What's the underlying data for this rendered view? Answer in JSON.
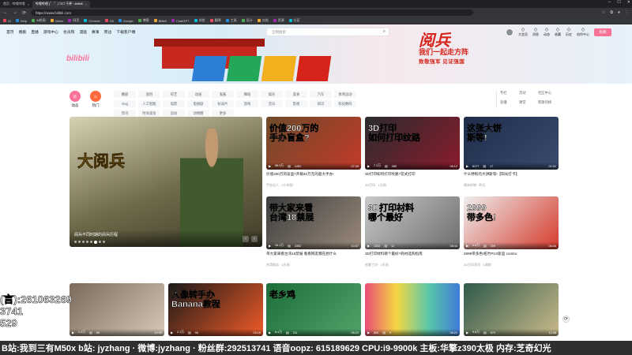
{
  "browser": {
    "tabs": [
      {
        "label": "首页 - 哔哩哔哩",
        "active": false
      },
      {
        "label": "哔哩哔哩 (゜-゜)つロ 干杯~-bilibili",
        "active": true
      }
    ],
    "url": "https://www.bilibili.com",
    "bookmarks": [
      "AI",
      "Help",
      "Ai绘画",
      "Vision",
      "网页",
      "Chrome",
      "Git",
      "Google",
      "博客",
      "Bilibili",
      "ChatGPT",
      "浏览",
      "翻译",
      "工具",
      "设计",
      "文档",
      "资源",
      "社区"
    ]
  },
  "header": {
    "nav": [
      "首页",
      "番剧",
      "直播",
      "游戏中心",
      "会员购",
      "漫画",
      "赛事",
      "周边",
      "下载客户端"
    ],
    "search_placeholder": "全网搜索",
    "user_items": [
      "大会员",
      "消息",
      "动态",
      "收藏",
      "历史",
      "创作中心"
    ],
    "upload_label": "投稿",
    "logo_text": "bilibili"
  },
  "banner": {
    "title": "阅兵",
    "subtitle": "我们一起走方阵",
    "slogan": "致敬强军  见证强国"
  },
  "channels": {
    "circle_items": [
      {
        "label": "动态",
        "color": "#fb7299"
      },
      {
        "label": "热门",
        "color": "#fb7299"
      }
    ],
    "chips": [
      "番剧",
      "国创",
      "综艺",
      "动画",
      "鬼畜",
      "舞蹈",
      "娱乐",
      "美食",
      "汽车",
      "体育运动",
      "vlog",
      "人工智能",
      "电影",
      "电视剧",
      "纪录片",
      "游戏",
      "音乐",
      "影视",
      "知识",
      "科技数码",
      "资讯",
      "时尚美妆",
      "运动",
      "动物圈",
      "更多"
    ],
    "quick": [
      "专栏",
      "活动",
      "社区中心",
      "直播",
      "课堂",
      "新歌热榜"
    ]
  },
  "carousel": {
    "title": "大阅兵",
    "caption": "阅兵不同时期的阅兵历程"
  },
  "videos": [
    {
      "thumb_text": "价值200万的\n手办盲盒?",
      "views": "36.9万",
      "likes": "1281",
      "duration": "07:49",
      "title": "价值200万的盲盒?开箱40万元的超大手办!",
      "meta": "手办达人 · 2小时前",
      "thumb_bg": "linear-gradient(135deg,#6e4b2a,#c23a2b)"
    },
    {
      "thumb_text": "3D打印\n如何打印纹路",
      "views": "7.2万",
      "likes": "380",
      "duration": "06:12",
      "title": "3D打印如何打印纹路?花式打印",
      "meta": "3D打印 · 1天前",
      "thumb_bg": "linear-gradient(135deg,#2a2c2e,#8b1b2c)"
    },
    {
      "thumb_text": "这张大饼\n斯等!",
      "views": "8177",
      "likes": "17",
      "duration": "01:01",
      "title": "什么特别的大饼斯等!【阳光打卡】",
      "meta": "周末好物 · 昨天",
      "thumb_bg": "linear-gradient(135deg,#1e2d4a,#3a4b6e)"
    },
    {
      "thumb_text": "带大家来看\n台湾18禁展",
      "views": "16.1万",
      "likes": "4352",
      "duration": "10:57",
      "title": "带大家来看台湾18禁展 看看网友都在想什么",
      "meta": "台湾探店 · 3天前",
      "thumb_bg": "linear-gradient(135deg,#3d3d3d,#9a8a7a)"
    },
    {
      "thumb_text": "3D打印材料\n哪个最好",
      "views": "1302",
      "likes": "12",
      "duration": "08:44",
      "title": "3D打印材料哪个最好?耗材选购指南",
      "meta": "创客工坊 · 2天前",
      "thumb_bg": "linear-gradient(135deg,#c9c9c9,#6d6d6d)"
    },
    {
      "thumb_text": "2999\n带多色!",
      "views": "4.8万",
      "likes": "309",
      "duration": "06:44",
      "title": "2999带多色!拓竹P1S新品 combo",
      "meta": "3D打印资讯 · 1周前",
      "thumb_bg": "linear-gradient(135deg,#eeeeee,#d53a2b)"
    },
    {
      "thumb_text": "",
      "views": "1.2万",
      "likes": "88",
      "duration": "10:03",
      "title": "",
      "meta": "",
      "thumb_bg": "linear-gradient(135deg,#7b6a5c,#d6c8b8)"
    },
    {
      "thumb_text": "人像转手办\nBanana教程",
      "views": "2.1万",
      "likes": "96",
      "duration": "03:15",
      "title": "",
      "meta": "",
      "thumb_bg": "linear-gradient(135deg,#1a1a1a,#f05a28)"
    },
    {
      "thumb_text": "老乡鸡",
      "views": "6.4万",
      "likes": "211",
      "duration": "05:22",
      "title": "",
      "meta": "",
      "thumb_bg": "linear-gradient(135deg,#1d6e3a,#4fa36a)"
    },
    {
      "thumb_text": "",
      "views": "800",
      "likes": "9",
      "duration": "06:21",
      "title": "",
      "meta": "",
      "thumb_bg": "linear-gradient(90deg,#e94e77,#f6d743,#5ac8a8,#3f7bd9)"
    },
    {
      "thumb_text": "",
      "views": "9.6万",
      "likes": "870",
      "duration": "12:08",
      "title": "",
      "meta": "",
      "thumb_bg": "linear-gradient(135deg,#2f5a4a,#c9b98a)"
    }
  ],
  "overlay": {
    "lines": [
      "(言):261063269",
      "3741",
      "529"
    ],
    "ticker": "B站:我到三有M50x  b站: jyzhang  ·  微博:jyzhang  ·  粉丝群:292513741  语音oopz: 615189629  CPU:i9-9900k 主板:华擎z390太极 内存:芝奇幻光"
  },
  "colors": {
    "accent": "#fb7299",
    "banner_red": "#d6241a"
  }
}
